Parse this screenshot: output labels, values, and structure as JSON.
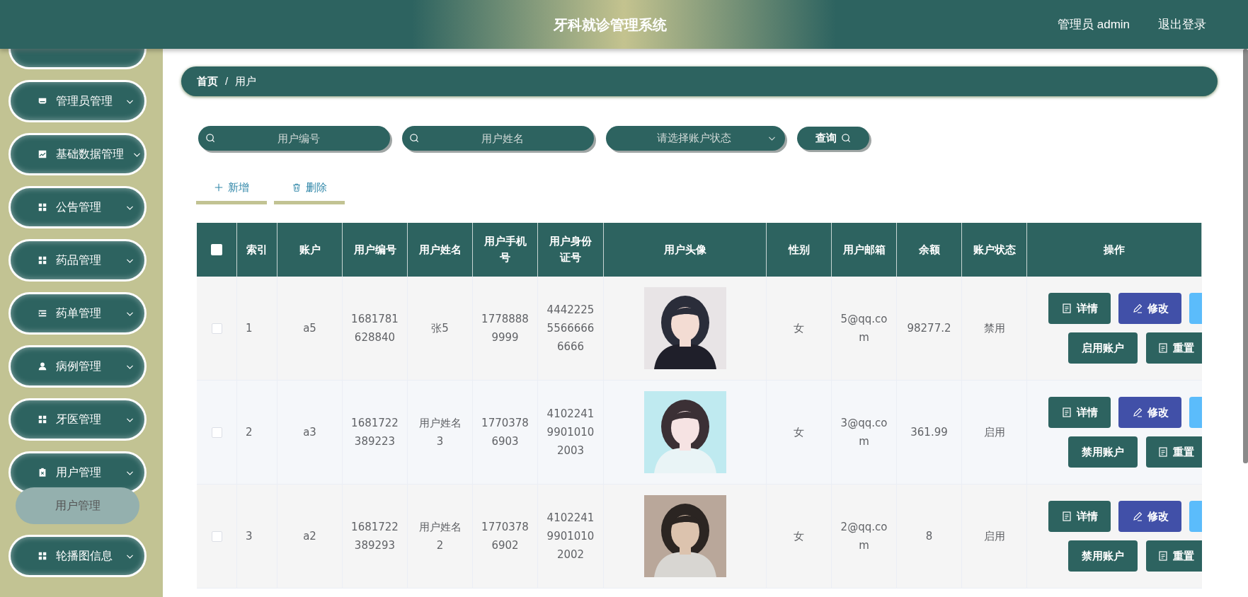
{
  "header": {
    "title": "牙科就诊管理系统",
    "user": "管理员 admin",
    "logout": "退出登录"
  },
  "sidebar": {
    "items": [
      {
        "kind": "cut"
      },
      {
        "kind": "menu",
        "label": "管理员管理"
      },
      {
        "kind": "menu",
        "label": "基础数据管理"
      },
      {
        "kind": "menu",
        "label": "公告管理"
      },
      {
        "kind": "menu",
        "label": "药品管理"
      },
      {
        "kind": "menu",
        "label": "药单管理"
      },
      {
        "kind": "menu",
        "label": "病例管理"
      },
      {
        "kind": "menu",
        "label": "牙医管理"
      },
      {
        "kind": "menu",
        "label": "用户管理",
        "children": [
          {
            "label": "用户管理"
          }
        ]
      },
      {
        "kind": "menu",
        "label": "轮播图信息"
      }
    ]
  },
  "breadcrumb": [
    "首页",
    "/",
    "用户"
  ],
  "search": {
    "fields": [
      {
        "placeholder": "用户编号"
      },
      {
        "placeholder": "用户姓名"
      }
    ],
    "status_select": {
      "placeholder": "请选择账户状态"
    },
    "query_button": "查询"
  },
  "actions": [
    {
      "kind": "add",
      "label": "新增"
    },
    {
      "kind": "delete",
      "label": "删除"
    }
  ],
  "table": {
    "select_all": {
      "checked": false
    },
    "columns": [
      "索引",
      "账户",
      "用户编号",
      "用户姓名",
      "用户手机号",
      "用户身份证号",
      "用户头像",
      "性别",
      "用户邮箱",
      "余额",
      "账户状态",
      "操作"
    ],
    "rows": [
      {
        "checked": false,
        "cells": [
          "1",
          "a5",
          "1681781628840",
          "张5",
          "17788889999",
          "444222555666666666"
        ],
        "avatar": {
          "kind": "picture"
        },
        "cells2": [
          "女",
          "5@qq.com",
          "98277.2",
          "禁用"
        ],
        "buttons": [
          {
            "kind": "detail",
            "label": "详情"
          },
          {
            "kind": "edit",
            "label": "修改"
          },
          {
            "kind": "blank"
          }
        ],
        "buttons2": [
          {
            "kind": "toggle",
            "label": "启用账户"
          },
          {
            "kind": "reset",
            "label": "重置"
          }
        ]
      },
      {
        "checked": false,
        "cells": [
          "2",
          "a3",
          "1681722389223",
          "用户姓名3",
          "17703786903",
          "410224199010102003"
        ],
        "avatar": {
          "kind": "picture"
        },
        "cells2": [
          "女",
          "3@qq.com",
          "361.99",
          "启用"
        ],
        "buttons": [
          {
            "kind": "detail",
            "label": "详情"
          },
          {
            "kind": "edit",
            "label": "修改"
          },
          {
            "kind": "blank"
          }
        ],
        "buttons2": [
          {
            "kind": "toggle",
            "label": "禁用账户"
          },
          {
            "kind": "reset",
            "label": "重置"
          }
        ]
      },
      {
        "checked": false,
        "cells": [
          "3",
          "a2",
          "1681722389293",
          "用户姓名2",
          "17703786902",
          "410224199010102002"
        ],
        "avatar": {
          "kind": "picture"
        },
        "cells2": [
          "女",
          "2@qq.com",
          "8",
          "启用"
        ],
        "buttons": [
          {
            "kind": "detail",
            "label": "详情"
          },
          {
            "kind": "edit",
            "label": "修改"
          },
          {
            "kind": "blank"
          }
        ],
        "buttons2": [
          {
            "kind": "toggle",
            "label": "禁用账户"
          },
          {
            "kind": "reset",
            "label": "重置"
          }
        ]
      }
    ]
  }
}
